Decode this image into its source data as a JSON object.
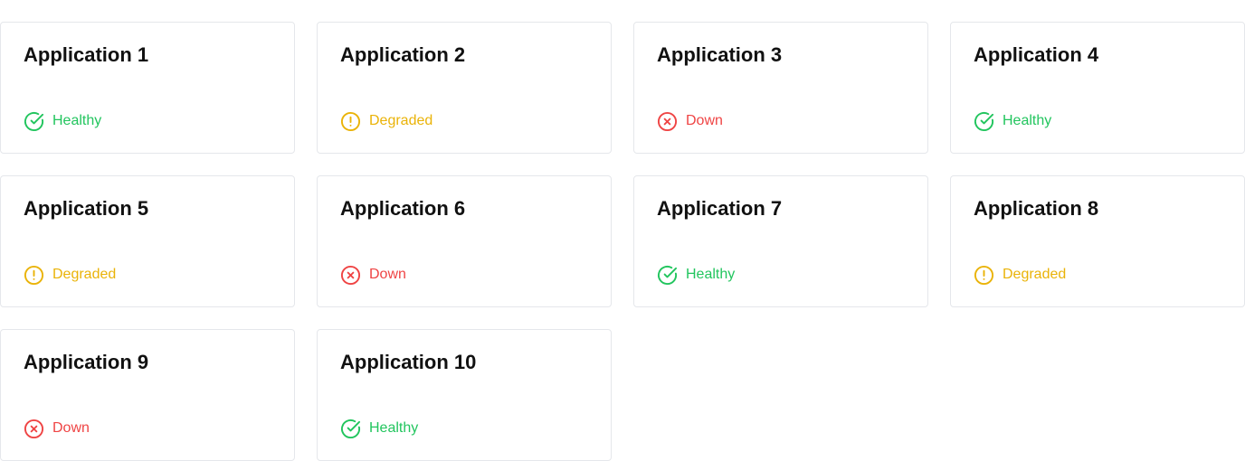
{
  "colors": {
    "healthy": "#22c55e",
    "degraded": "#eab308",
    "down": "#ef4444",
    "card_border": "#e5e7eb",
    "title": "#111111"
  },
  "icons": {
    "healthy": "check-circle-icon",
    "degraded": "alert-circle-icon",
    "down": "x-circle-icon"
  },
  "applications": [
    {
      "name": "Application 1",
      "status": "Healthy"
    },
    {
      "name": "Application 2",
      "status": "Degraded"
    },
    {
      "name": "Application 3",
      "status": "Down"
    },
    {
      "name": "Application 4",
      "status": "Healthy"
    },
    {
      "name": "Application 5",
      "status": "Degraded"
    },
    {
      "name": "Application 6",
      "status": "Down"
    },
    {
      "name": "Application 7",
      "status": "Healthy"
    },
    {
      "name": "Application 8",
      "status": "Degraded"
    },
    {
      "name": "Application 9",
      "status": "Down"
    },
    {
      "name": "Application 10",
      "status": "Healthy"
    }
  ]
}
